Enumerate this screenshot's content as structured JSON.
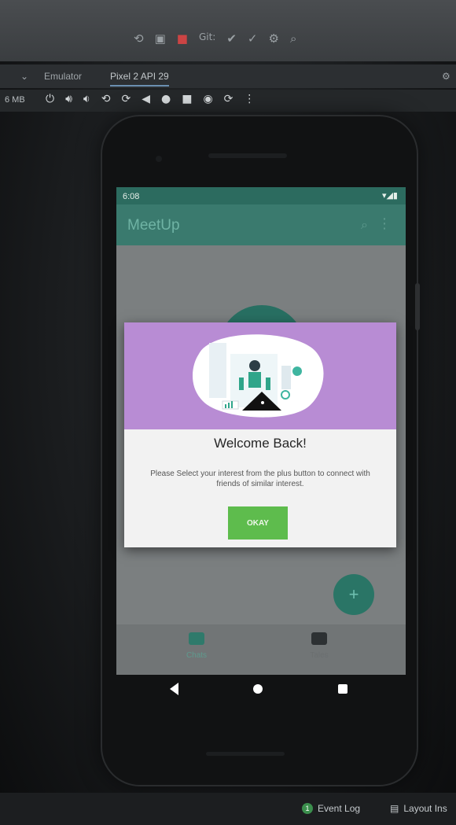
{
  "ide": {
    "tabs": [
      {
        "label": "Emulator"
      },
      {
        "label": "Pixel 2 API 29"
      }
    ],
    "memory": "6 MB",
    "git_label": "Git:",
    "status": {
      "event_log_count": "1",
      "event_log": "Event Log",
      "layout_inspector": "Layout Ins"
    }
  },
  "device": {
    "statusbar": {
      "time": "6:08",
      "icons": "▾◢▮"
    },
    "app": {
      "title": "MeetUp",
      "search_icon": "search-icon",
      "more_icon": "more-vert-icon"
    },
    "dialog": {
      "title": "Welcome Back!",
      "message": "Please Select your interest from the plus button to connect with friends of similar interest.",
      "button": "OKAY"
    },
    "fab": {
      "icon": "plus-icon",
      "glyph": "+"
    },
    "bottom_nav": [
      {
        "label": "Chats",
        "icon": "chat-icon"
      },
      {
        "label": "Tales",
        "icon": "image-icon"
      }
    ]
  },
  "colors": {
    "primary": "#3a7a6e",
    "primary_dark": "#2c6b5f",
    "accent_button": "#5ebc4d",
    "dialog_header": "#b88cd4"
  }
}
